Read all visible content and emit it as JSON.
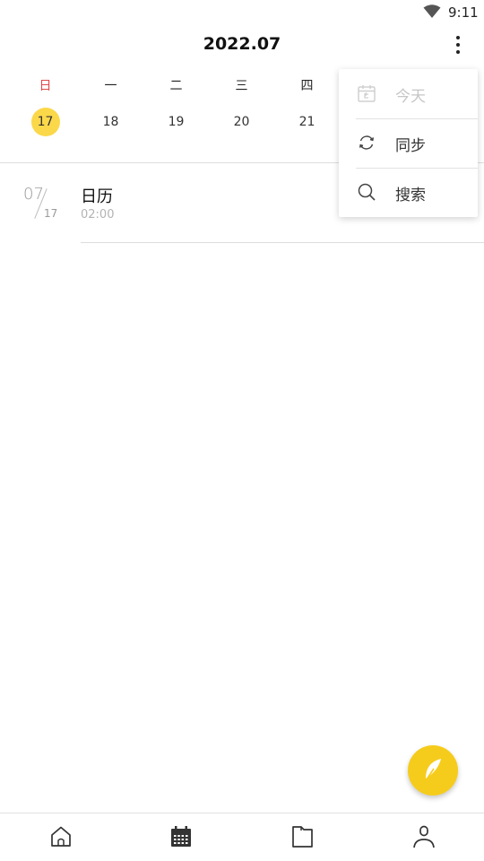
{
  "status_bar": {
    "time": "9:11",
    "wifi_icon": "wifi-icon"
  },
  "header": {
    "title": "2022.07",
    "more_icon": "more-vertical-icon"
  },
  "week": {
    "days": [
      {
        "name": "日",
        "date": "17",
        "selected": true,
        "sunday": true
      },
      {
        "name": "一",
        "date": "18"
      },
      {
        "name": "二",
        "date": "19"
      },
      {
        "name": "三",
        "date": "20"
      },
      {
        "name": "四",
        "date": "21"
      }
    ]
  },
  "event": {
    "month": "07",
    "day": "17",
    "title": "日历",
    "time": "02:00"
  },
  "menu": {
    "items": [
      {
        "label": "今天",
        "icon": "calendar-today-icon",
        "disabled": true
      },
      {
        "label": "同步",
        "icon": "sync-icon"
      },
      {
        "label": "搜索",
        "icon": "search-icon"
      }
    ]
  },
  "fab": {
    "icon": "feather-icon"
  },
  "bottom_nav": {
    "items": [
      {
        "icon": "home-icon"
      },
      {
        "icon": "calendar-icon",
        "active": true
      },
      {
        "icon": "document-icon"
      },
      {
        "icon": "profile-icon"
      }
    ]
  },
  "colors": {
    "accent": "#f6cc1c",
    "selected_day": "#fbd84a",
    "sunday": "#e04848",
    "muted_text": "#b3b3b3"
  }
}
